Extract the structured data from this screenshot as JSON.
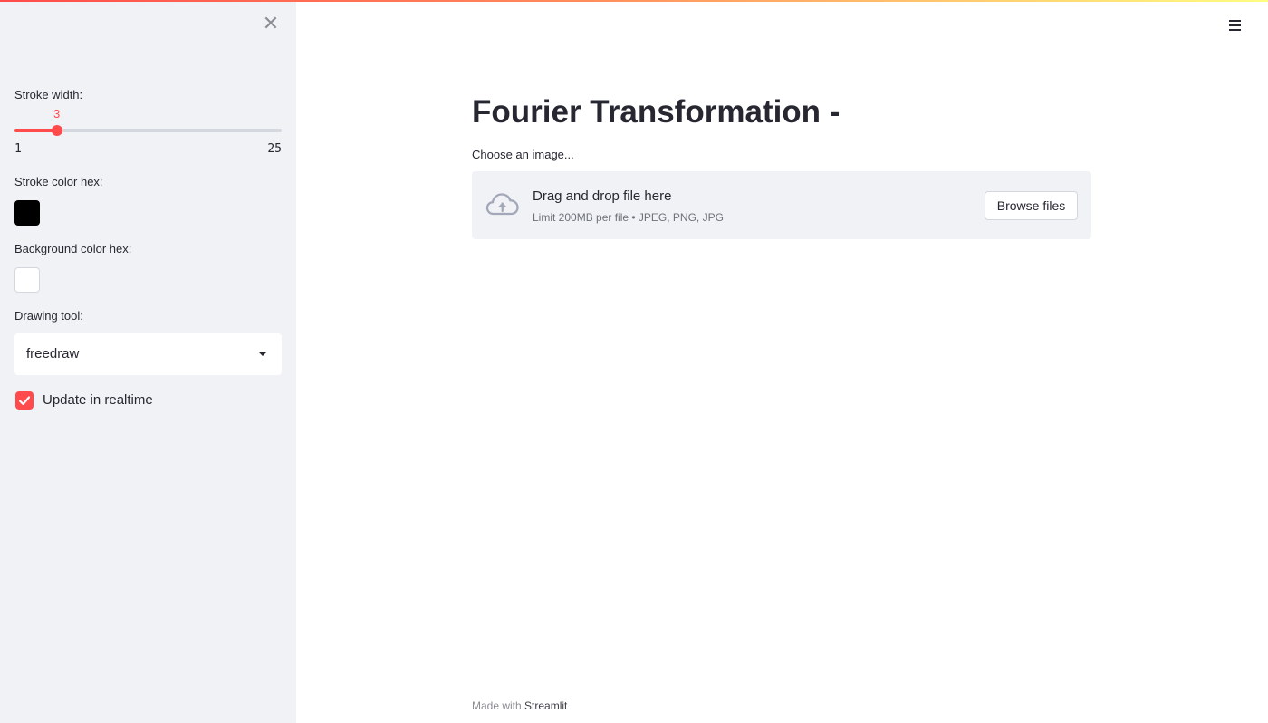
{
  "sidebar": {
    "stroke_width": {
      "label": "Stroke width:",
      "value": 3,
      "value_text": "3",
      "min": 1,
      "max": 25,
      "min_text": "1",
      "max_text": "25"
    },
    "stroke_color": {
      "label": "Stroke color hex:",
      "value": "#000000"
    },
    "background_color": {
      "label": "Background color hex:",
      "value": "#ffffff"
    },
    "drawing_tool": {
      "label": "Drawing tool:",
      "value": "freedraw"
    },
    "realtime": {
      "label": "Update in realtime",
      "checked": true
    },
    "close_icon": "close-icon"
  },
  "main": {
    "title": "Fourier Transformation -",
    "uploader": {
      "label": "Choose an image...",
      "drop_text": "Drag and drop file here",
      "limit_text": "Limit 200MB per file • JPEG, PNG, JPG",
      "button_label": "Browse files",
      "icon": "cloud-upload-icon"
    },
    "menu_icon": "hamburger-menu-icon"
  },
  "footer": {
    "prefix": "Made with",
    "link": "Streamlit"
  },
  "colors": {
    "accent": "#ff4b4b",
    "sidebar_bg": "#f0f2f6",
    "text": "#262730"
  }
}
